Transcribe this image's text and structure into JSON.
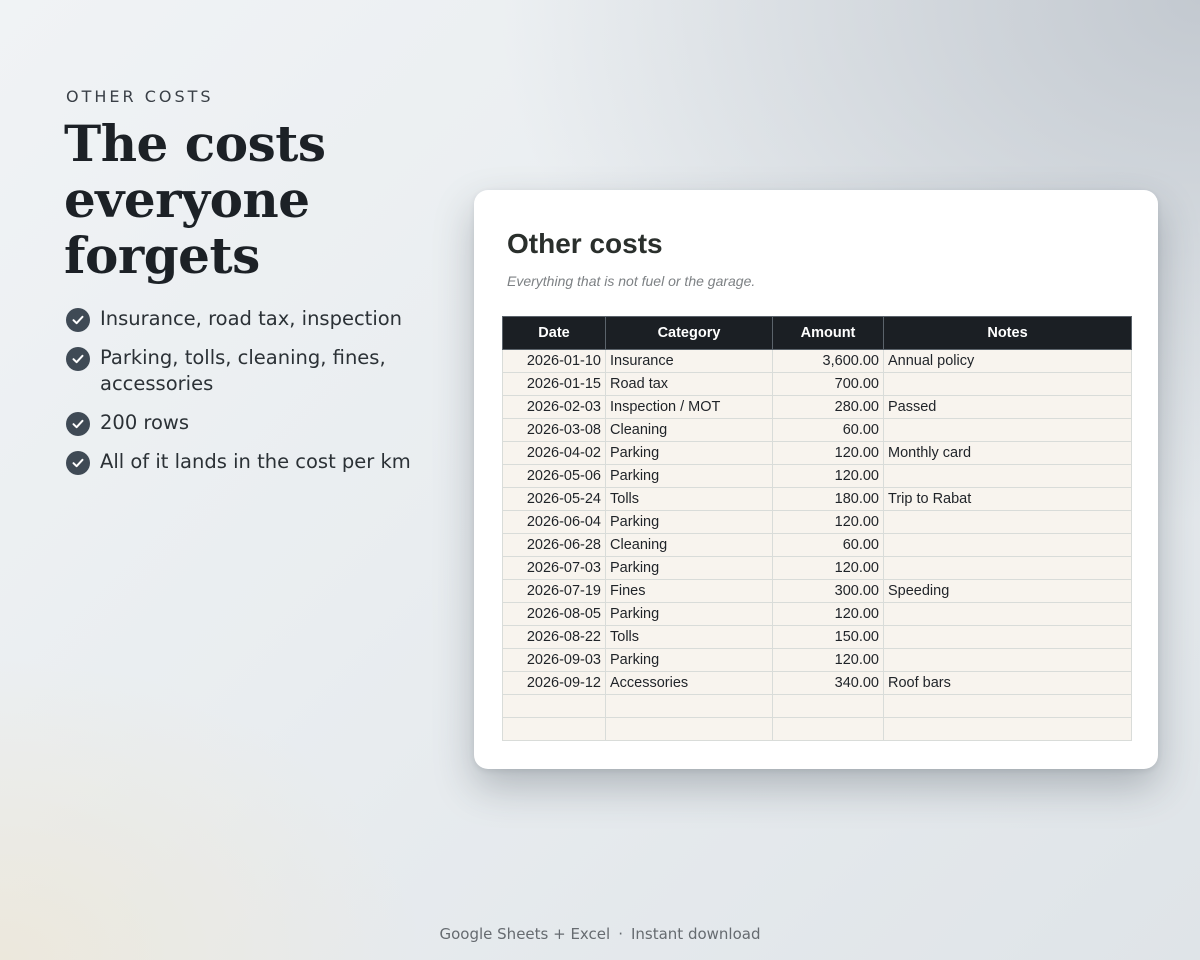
{
  "hero": {
    "eyebrow": "OTHER COSTS",
    "headline": "The costs everyone forgets",
    "features": [
      "Insurance, road tax, inspection",
      "Parking, tolls, cleaning, fines, accessories",
      "200 rows",
      "All of it lands in the cost per km"
    ],
    "feature_icon": "check-circle-icon"
  },
  "sheet": {
    "title": "Other costs",
    "subtitle": "Everything that is not fuel or the garage.",
    "columns": [
      "Date",
      "Category",
      "Amount",
      "Notes"
    ],
    "rows": [
      [
        "2026-01-10",
        "Insurance",
        "3,600.00",
        "Annual policy"
      ],
      [
        "2026-01-15",
        "Road tax",
        "700.00",
        ""
      ],
      [
        "2026-02-03",
        "Inspection / MOT",
        "280.00",
        "Passed"
      ],
      [
        "2026-03-08",
        "Cleaning",
        "60.00",
        ""
      ],
      [
        "2026-04-02",
        "Parking",
        "120.00",
        "Monthly card"
      ],
      [
        "2026-05-06",
        "Parking",
        "120.00",
        ""
      ],
      [
        "2026-05-24",
        "Tolls",
        "180.00",
        "Trip to Rabat"
      ],
      [
        "2026-06-04",
        "Parking",
        "120.00",
        ""
      ],
      [
        "2026-06-28",
        "Cleaning",
        "60.00",
        ""
      ],
      [
        "2026-07-03",
        "Parking",
        "120.00",
        ""
      ],
      [
        "2026-07-19",
        "Fines",
        "300.00",
        "Speeding"
      ],
      [
        "2026-08-05",
        "Parking",
        "120.00",
        ""
      ],
      [
        "2026-08-22",
        "Tolls",
        "150.00",
        ""
      ],
      [
        "2026-09-03",
        "Parking",
        "120.00",
        ""
      ],
      [
        "2026-09-12",
        "Accessories",
        "340.00",
        "Roof bars"
      ],
      [
        "",
        "",
        "",
        ""
      ],
      [
        "",
        "",
        "",
        ""
      ]
    ]
  },
  "footer": {
    "left": "Google Sheets + Excel",
    "separator": "·",
    "right": "Instant download"
  },
  "colors": {
    "header_bg": "#1b1f24",
    "cell_bg": "#f8f4ee",
    "check_bg": "#3f4a55"
  }
}
